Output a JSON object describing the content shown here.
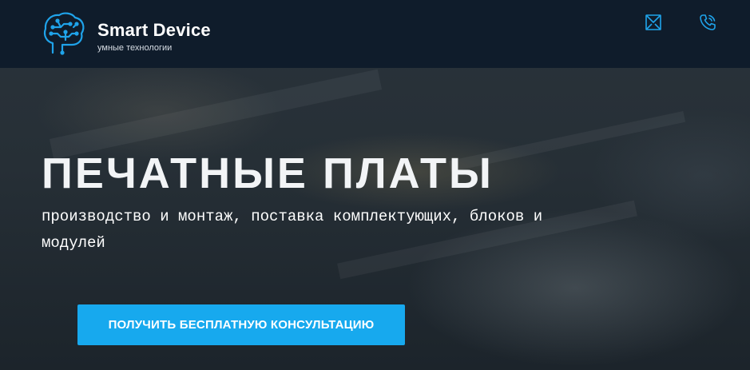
{
  "header": {
    "brand_name": "Smart Device",
    "tagline": "умные технологии",
    "icons": [
      "mail-icon",
      "phone-icon"
    ]
  },
  "hero": {
    "title": "ПЕЧАТНЫЕ ПЛАТЫ",
    "subtitle": "производство и монтаж, поставка комплектующих, блоков и модулей",
    "cta_label": "ПОЛУЧИТЬ БЕСПЛАТНУЮ КОНСУЛЬТАЦИЮ"
  },
  "colors": {
    "header_bg": "#0f1c2b",
    "accent": "#17a9ee",
    "text": "#ffffff"
  }
}
